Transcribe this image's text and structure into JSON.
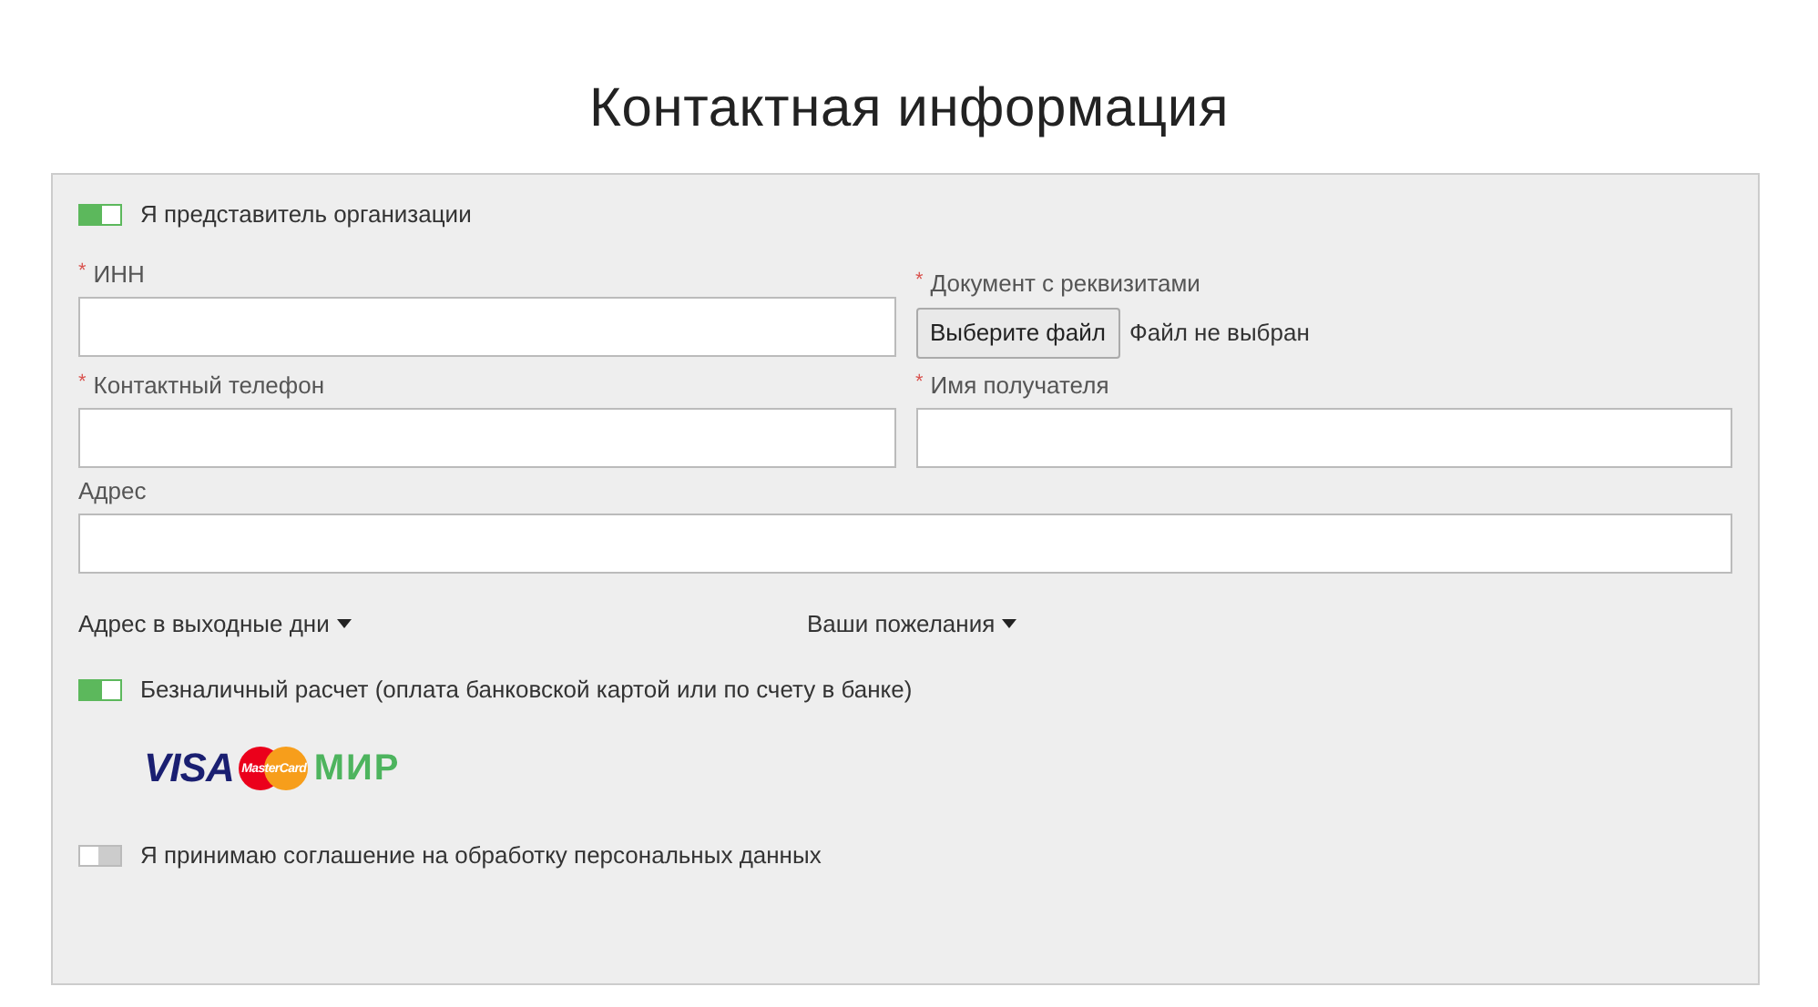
{
  "title": "Контактная информация",
  "form": {
    "required_mark": "*",
    "organization_toggle": {
      "label": "Я представитель организации",
      "on": true
    },
    "rows": [
      [
        {
          "kind": "text",
          "label": "ИНН",
          "required": true
        },
        {
          "kind": "file",
          "label": "Документ с реквизитами",
          "required": true,
          "button": "Выберите файл",
          "status": "Файл не выбран"
        }
      ],
      [
        {
          "kind": "text",
          "label": "Контактный телефон",
          "required": true
        },
        {
          "kind": "text",
          "label": "Имя получателя",
          "required": true
        }
      ],
      [
        {
          "kind": "text",
          "label": "Адрес",
          "required": false
        }
      ]
    ],
    "dropdowns": [
      {
        "label": "Адрес в выходные дни"
      },
      {
        "label": "Ваши пожелания"
      }
    ],
    "cashless_toggle": {
      "label": "Безналичный расчет (оплата банковской картой или по счету в банке)",
      "on": true
    },
    "payment_logos": [
      {
        "kind": "visa",
        "text": "VISA"
      },
      {
        "kind": "mastercard",
        "text": "MasterCard"
      },
      {
        "kind": "mir",
        "text": "МИР"
      }
    ],
    "consent_toggle": {
      "label": "Я принимаю соглашение на обработку персональных данных",
      "on": false
    }
  }
}
